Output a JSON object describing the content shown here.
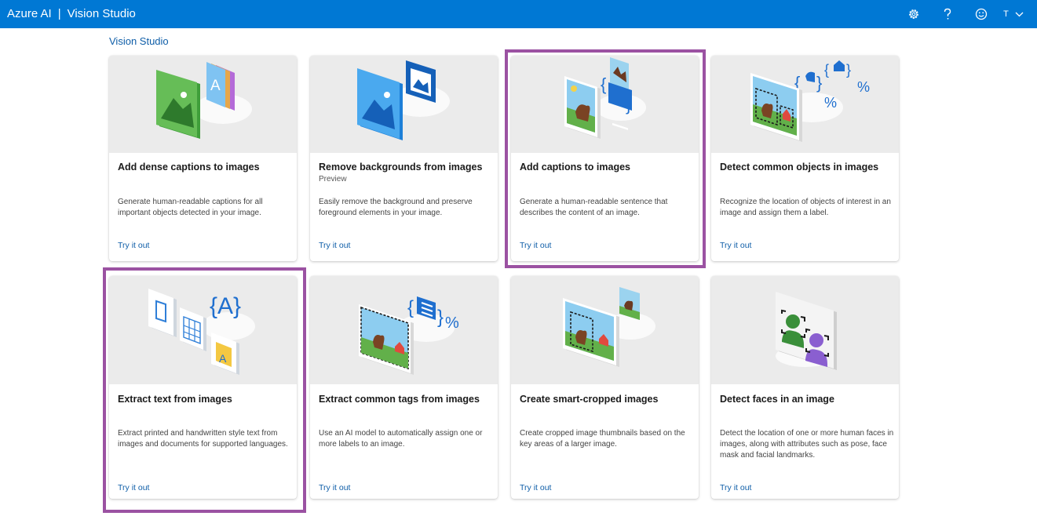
{
  "header": {
    "brand_left": "Azure AI",
    "brand_sep": "|",
    "brand_right": "Vision Studio",
    "user_initial": "T"
  },
  "breadcrumb": "Vision Studio",
  "colors": {
    "header_bg": "#0078d4",
    "link": "#0f5ea8",
    "highlight": "#9b52a2",
    "card_hero_bg": "#ebebeb"
  },
  "icons": [
    "settings-gear-icon",
    "help-question-icon",
    "feedback-smiley-icon",
    "chevron-down-icon"
  ],
  "cards": [
    {
      "title": "Add dense captions to images",
      "badge": "",
      "description": "Generate human-readable captions for all important objects detected in your image.",
      "link": "Try it out",
      "highlighted": false
    },
    {
      "title": "Remove backgrounds from images",
      "badge": "Preview",
      "description": "Easily remove the background and preserve foreground elements in your image.",
      "link": "Try it out",
      "highlighted": false
    },
    {
      "title": "Add captions to images",
      "badge": "",
      "description": "Generate a human-readable sentence that describes the content of an image.",
      "link": "Try it out",
      "highlighted": true
    },
    {
      "title": "Detect common objects in images",
      "badge": "",
      "description": "Recognize the location of objects of interest in an image and assign them a label.",
      "link": "Try it out",
      "highlighted": false
    },
    {
      "title": "Extract text from images",
      "badge": "",
      "description": "Extract printed and handwritten style text from images and documents for supported languages.",
      "link": "Try it out",
      "highlighted": true
    },
    {
      "title": "Extract common tags from images",
      "badge": "",
      "description": "Use an AI model to automatically assign one or more labels to an image.",
      "link": "Try it out",
      "highlighted": false
    },
    {
      "title": "Create smart-cropped images",
      "badge": "",
      "description": "Create cropped image thumbnails based on the key areas of a larger image.",
      "link": "Try it out",
      "highlighted": false
    },
    {
      "title": "Detect faces in an image",
      "badge": "",
      "description": "Detect the location of one or more human faces in images, along with attributes such as pose, face mask and facial landmarks.",
      "link": "Try it out",
      "highlighted": false
    }
  ]
}
